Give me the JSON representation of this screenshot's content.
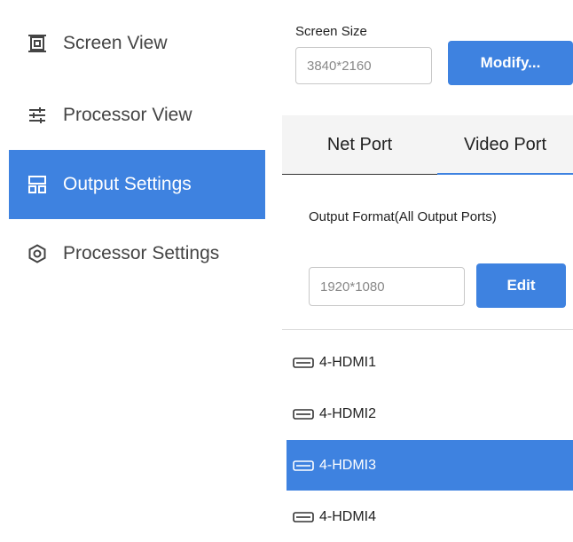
{
  "sidebar": {
    "items": [
      {
        "label": "Screen View",
        "icon": "screen-icon"
      },
      {
        "label": "Processor View",
        "icon": "sliders-icon"
      },
      {
        "label": "Output Settings",
        "icon": "layout-icon"
      },
      {
        "label": "Processor Settings",
        "icon": "gear-icon"
      }
    ],
    "active_index": 2
  },
  "screen_size": {
    "label": "Screen Size",
    "value": "3840*2160",
    "button": "Modify..."
  },
  "tabs": [
    {
      "label": "Net Port"
    },
    {
      "label": "Video Port"
    }
  ],
  "active_tab": 1,
  "output_format": {
    "label": "Output Format(All Output Ports)",
    "value": "1920*1080",
    "button": "Edit"
  },
  "ports": [
    {
      "label": "4-HDMI1",
      "icon": "hdmi-icon"
    },
    {
      "label": "4-HDMI2",
      "icon": "hdmi-icon"
    },
    {
      "label": "4-HDMI3",
      "icon": "hdmi-icon"
    },
    {
      "label": "4-HDMI4",
      "icon": "hdmi-icon"
    }
  ],
  "active_port": 2,
  "colors": {
    "accent": "#3e82e0"
  }
}
